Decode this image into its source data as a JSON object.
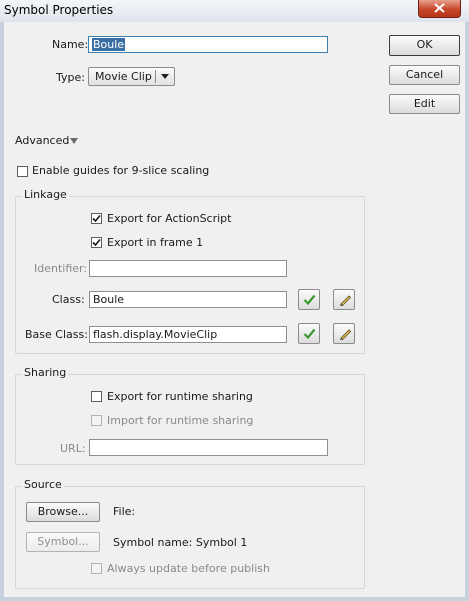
{
  "window": {
    "title": "Symbol Properties"
  },
  "name_field": {
    "label": "Name:",
    "value": "Boule"
  },
  "type_field": {
    "label": "Type:",
    "selected": "Movie Clip"
  },
  "buttons": {
    "ok": "OK",
    "cancel": "Cancel",
    "edit": "Edit"
  },
  "advanced": {
    "label": "Advanced"
  },
  "nine_slice": {
    "label": "Enable guides for 9-slice scaling",
    "checked": false
  },
  "linkage": {
    "title": "Linkage",
    "export_actionscript": {
      "label": "Export for ActionScript",
      "checked": true
    },
    "export_frame1": {
      "label": "Export in frame 1",
      "checked": true
    },
    "identifier": {
      "label": "Identifier:",
      "value": ""
    },
    "class": {
      "label": "Class:",
      "value": "Boule"
    },
    "base_class": {
      "label": "Base Class:",
      "value": "flash.display.MovieClip"
    }
  },
  "sharing": {
    "title": "Sharing",
    "export_runtime": {
      "label": "Export for runtime sharing",
      "checked": false
    },
    "import_runtime": {
      "label": "Import for runtime sharing",
      "checked": false,
      "enabled": false
    },
    "url": {
      "label": "URL:",
      "value": ""
    }
  },
  "source": {
    "title": "Source",
    "browse_label": "Browse...",
    "file_label": "File:",
    "symbol_label": "Symbol...",
    "symbol_name_label": "Symbol name: Symbol 1",
    "always_update": {
      "label": "Always update before publish",
      "checked": false,
      "enabled": false
    }
  },
  "colors": {
    "selection": "#3a6ea5",
    "check_green": "#3c9a2f",
    "close_red": "#c7472b"
  },
  "icons": {
    "check": "check-icon",
    "pencil": "pencil-icon",
    "close": "close-icon",
    "dropdown_arrow": "triangle-down-icon"
  }
}
